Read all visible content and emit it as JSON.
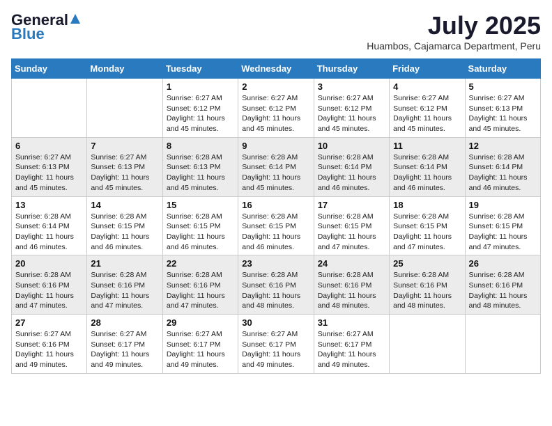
{
  "header": {
    "logo_general": "General",
    "logo_blue": "Blue",
    "month_title": "July 2025",
    "subtitle": "Huambos, Cajamarca Department, Peru"
  },
  "weekdays": [
    "Sunday",
    "Monday",
    "Tuesday",
    "Wednesday",
    "Thursday",
    "Friday",
    "Saturday"
  ],
  "weeks": [
    [
      {
        "day": "",
        "info": ""
      },
      {
        "day": "",
        "info": ""
      },
      {
        "day": "1",
        "info": "Sunrise: 6:27 AM\nSunset: 6:12 PM\nDaylight: 11 hours and 45 minutes."
      },
      {
        "day": "2",
        "info": "Sunrise: 6:27 AM\nSunset: 6:12 PM\nDaylight: 11 hours and 45 minutes."
      },
      {
        "day": "3",
        "info": "Sunrise: 6:27 AM\nSunset: 6:12 PM\nDaylight: 11 hours and 45 minutes."
      },
      {
        "day": "4",
        "info": "Sunrise: 6:27 AM\nSunset: 6:12 PM\nDaylight: 11 hours and 45 minutes."
      },
      {
        "day": "5",
        "info": "Sunrise: 6:27 AM\nSunset: 6:13 PM\nDaylight: 11 hours and 45 minutes."
      }
    ],
    [
      {
        "day": "6",
        "info": "Sunrise: 6:27 AM\nSunset: 6:13 PM\nDaylight: 11 hours and 45 minutes."
      },
      {
        "day": "7",
        "info": "Sunrise: 6:27 AM\nSunset: 6:13 PM\nDaylight: 11 hours and 45 minutes."
      },
      {
        "day": "8",
        "info": "Sunrise: 6:28 AM\nSunset: 6:13 PM\nDaylight: 11 hours and 45 minutes."
      },
      {
        "day": "9",
        "info": "Sunrise: 6:28 AM\nSunset: 6:14 PM\nDaylight: 11 hours and 45 minutes."
      },
      {
        "day": "10",
        "info": "Sunrise: 6:28 AM\nSunset: 6:14 PM\nDaylight: 11 hours and 46 minutes."
      },
      {
        "day": "11",
        "info": "Sunrise: 6:28 AM\nSunset: 6:14 PM\nDaylight: 11 hours and 46 minutes."
      },
      {
        "day": "12",
        "info": "Sunrise: 6:28 AM\nSunset: 6:14 PM\nDaylight: 11 hours and 46 minutes."
      }
    ],
    [
      {
        "day": "13",
        "info": "Sunrise: 6:28 AM\nSunset: 6:14 PM\nDaylight: 11 hours and 46 minutes."
      },
      {
        "day": "14",
        "info": "Sunrise: 6:28 AM\nSunset: 6:15 PM\nDaylight: 11 hours and 46 minutes."
      },
      {
        "day": "15",
        "info": "Sunrise: 6:28 AM\nSunset: 6:15 PM\nDaylight: 11 hours and 46 minutes."
      },
      {
        "day": "16",
        "info": "Sunrise: 6:28 AM\nSunset: 6:15 PM\nDaylight: 11 hours and 46 minutes."
      },
      {
        "day": "17",
        "info": "Sunrise: 6:28 AM\nSunset: 6:15 PM\nDaylight: 11 hours and 47 minutes."
      },
      {
        "day": "18",
        "info": "Sunrise: 6:28 AM\nSunset: 6:15 PM\nDaylight: 11 hours and 47 minutes."
      },
      {
        "day": "19",
        "info": "Sunrise: 6:28 AM\nSunset: 6:15 PM\nDaylight: 11 hours and 47 minutes."
      }
    ],
    [
      {
        "day": "20",
        "info": "Sunrise: 6:28 AM\nSunset: 6:16 PM\nDaylight: 11 hours and 47 minutes."
      },
      {
        "day": "21",
        "info": "Sunrise: 6:28 AM\nSunset: 6:16 PM\nDaylight: 11 hours and 47 minutes."
      },
      {
        "day": "22",
        "info": "Sunrise: 6:28 AM\nSunset: 6:16 PM\nDaylight: 11 hours and 47 minutes."
      },
      {
        "day": "23",
        "info": "Sunrise: 6:28 AM\nSunset: 6:16 PM\nDaylight: 11 hours and 48 minutes."
      },
      {
        "day": "24",
        "info": "Sunrise: 6:28 AM\nSunset: 6:16 PM\nDaylight: 11 hours and 48 minutes."
      },
      {
        "day": "25",
        "info": "Sunrise: 6:28 AM\nSunset: 6:16 PM\nDaylight: 11 hours and 48 minutes."
      },
      {
        "day": "26",
        "info": "Sunrise: 6:28 AM\nSunset: 6:16 PM\nDaylight: 11 hours and 48 minutes."
      }
    ],
    [
      {
        "day": "27",
        "info": "Sunrise: 6:27 AM\nSunset: 6:16 PM\nDaylight: 11 hours and 49 minutes."
      },
      {
        "day": "28",
        "info": "Sunrise: 6:27 AM\nSunset: 6:17 PM\nDaylight: 11 hours and 49 minutes."
      },
      {
        "day": "29",
        "info": "Sunrise: 6:27 AM\nSunset: 6:17 PM\nDaylight: 11 hours and 49 minutes."
      },
      {
        "day": "30",
        "info": "Sunrise: 6:27 AM\nSunset: 6:17 PM\nDaylight: 11 hours and 49 minutes."
      },
      {
        "day": "31",
        "info": "Sunrise: 6:27 AM\nSunset: 6:17 PM\nDaylight: 11 hours and 49 minutes."
      },
      {
        "day": "",
        "info": ""
      },
      {
        "day": "",
        "info": ""
      }
    ]
  ]
}
